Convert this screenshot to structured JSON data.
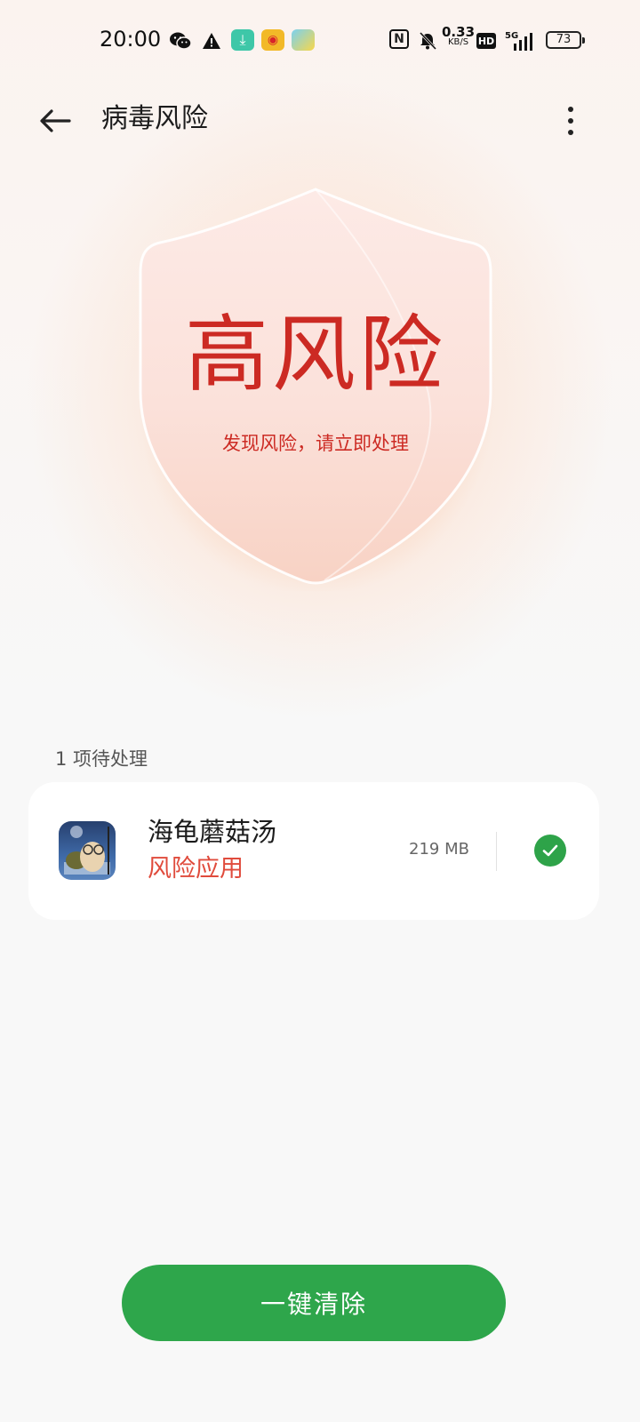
{
  "status_bar": {
    "time": "20:00",
    "net_speed_value": "0.33",
    "net_speed_unit": "KB/S",
    "hd": "HD",
    "network": "5G",
    "battery": "73"
  },
  "header": {
    "title": "病毒风险"
  },
  "shield": {
    "level": "高风险",
    "message": "发现风险，请立即处理"
  },
  "list": {
    "pending_label": "1 项待处理",
    "items": [
      {
        "name": "海龟蘑菇汤",
        "tag": "风险应用",
        "size": "219 MB",
        "checked": true
      }
    ]
  },
  "action": {
    "clean_label": "一键清除"
  },
  "colors": {
    "accent_green": "#2ea64b",
    "risk_red": "#cc2a23",
    "tag_red": "#e04b3c"
  },
  "icons": [
    "wechat-icon",
    "warning-icon",
    "download-icon",
    "weibo-icon",
    "game-icon",
    "nfc-icon",
    "mute-icon",
    "signal-icon",
    "battery-icon",
    "back-arrow-icon",
    "more-icon",
    "shield-icon",
    "check-icon"
  ]
}
